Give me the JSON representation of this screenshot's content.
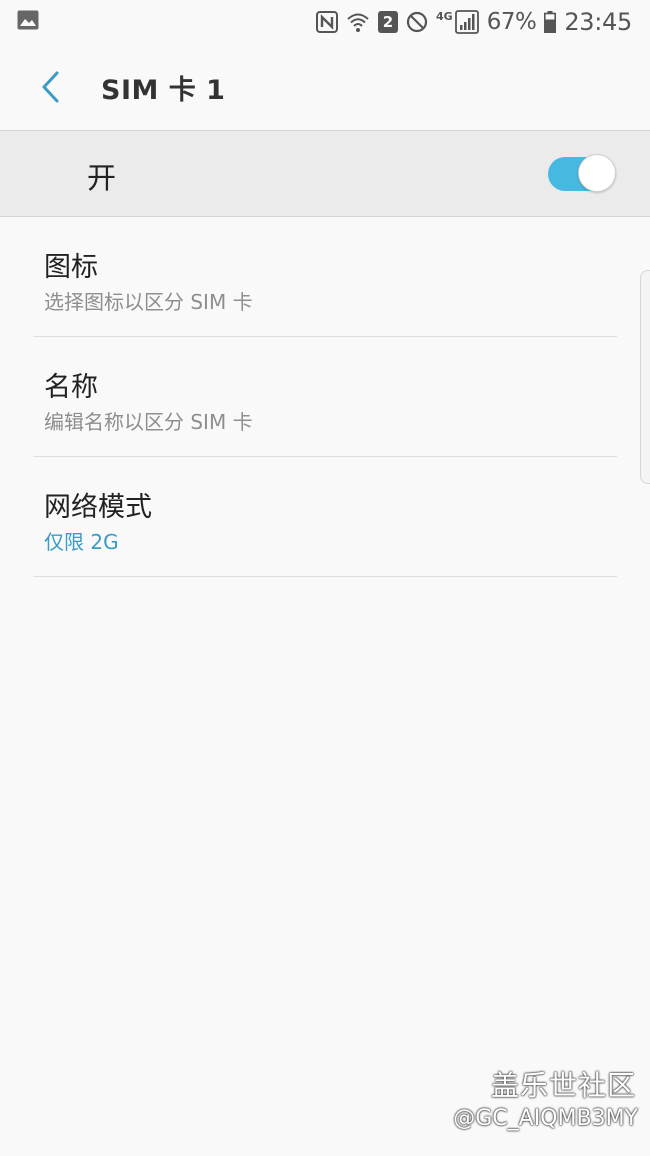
{
  "status_bar": {
    "left_icon": "gallery-icon",
    "nfc_icon": "nfc-icon",
    "wifi_icon": "wifi-icon",
    "sim_badge": "2",
    "dnd_icon": "do-not-disturb-icon",
    "network_label": "4G",
    "signal_icon": "signal-icon",
    "battery_percent": "67%",
    "battery_icon": "battery-icon",
    "time": "23:45"
  },
  "app_bar": {
    "back_icon": "chevron-left-icon",
    "title": "SIM 卡 1"
  },
  "master_switch": {
    "label": "开",
    "state": "on",
    "track_color": "#46b9e1"
  },
  "settings": {
    "items": [
      {
        "title": "图标",
        "summary": "选择图标以区分 SIM 卡"
      },
      {
        "title": "名称",
        "summary": "编辑名称以区分 SIM 卡"
      },
      {
        "title": "网络模式",
        "summary": "仅限 2G"
      }
    ]
  },
  "colors": {
    "accent": "#3a9cc4",
    "background": "#f9f9f9"
  },
  "watermark": {
    "title": "盖乐世社区",
    "handle": "@GC_AIQMB3MY"
  }
}
